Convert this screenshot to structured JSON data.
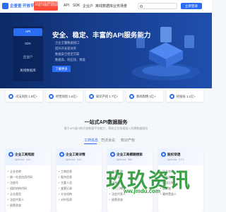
{
  "colors": {
    "accent": "#2a6df5",
    "hero_bg": "#173d8c",
    "promo_bg": "#ff4d3a",
    "watermark": "#2e9a3a"
  },
  "header": {
    "logo_text": "企查查 开放平台",
    "promo_lines": [
      "企业信息全面 数据源稳定可靠",
      "API接口 快速接入 免费试用"
    ],
    "nav_items": [
      "API",
      "SDK",
      "企业户",
      "离线数据库",
      "业务场景"
    ],
    "search_icon": "search-icon",
    "login_label": "立即登录"
  },
  "hero": {
    "side_items": [
      "API",
      "SDK",
      "企业户",
      "离线数据库"
    ],
    "title": "安全、稳定、丰富的API服务能力",
    "points": [
      "企业全量数据接口",
      "提升开发者效率",
      "数据安全稳定可靠",
      "数据高、响应快、精准"
    ],
    "cta_label": "了解更多"
  },
  "stats": [
    {
      "label": "司法风险 1.8亿+",
      "icon": "document-icon"
    },
    {
      "label": "经营风险 1.6亿+",
      "icon": "chart-icon"
    },
    {
      "label": "知识产权 1.7亿+",
      "icon": "bulb-icon"
    },
    {
      "label": "新闻舆情 1亿+",
      "icon": "news-icon"
    },
    {
      "label": "招投标 1.1亿+",
      "icon": "bid-icon"
    }
  ],
  "section": {
    "title": "一站式API数据服务",
    "subtitle": "基于API接口的开放数据平台能力，帮助企业快速接入所需数据服务",
    "tabs": [
      "工商信息",
      "司法诉讼",
      "知识产权"
    ],
    "active_tab": 0
  },
  "cards": [
    {
      "title": "企业工商照面",
      "code": "ApiCode：410",
      "items": [
        "企业名称",
        "统一社会信用代码",
        "注册号",
        "组织机构代码",
        "企业类型",
        "法定代表人",
        "经营状态"
      ]
    },
    {
      "title": "企业工商详情",
      "code": "ApiCode：410",
      "items": [
        "工商信息",
        "股东信息",
        "主要人员",
        "变更记录",
        "分支机构",
        "对外投资"
      ]
    },
    {
      "title": "企业工商模糊搜索",
      "code": "ApiCode：886",
      "items": [
        "企业名称",
        "企业类型",
        "注册资本",
        "成立日期",
        "法定代表人",
        "经营状态"
      ]
    },
    {
      "title": "股权穿透",
      "code": "ApiCode：2171",
      "items": [
        "企业名称",
        "股东名称",
        "持股比例",
        "股权链",
        "最终受益人"
      ]
    }
  ],
  "watermark": {
    "text": "玖玖资讯",
    "url": "ww.jmdu.com"
  }
}
